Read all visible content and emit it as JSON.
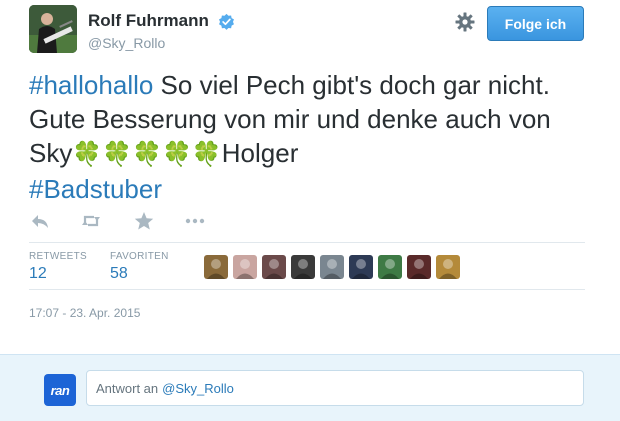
{
  "user": {
    "name": "Rolf Fuhrmann",
    "handle": "@Sky_Rollo"
  },
  "follow_button": {
    "label": "Folge ich"
  },
  "tweet": {
    "hashtag1": "#hallohallo",
    "text_part1": " So viel Pech gibt's doch gar nicht. Gute Besserung von mir und denke auch von Sky",
    "clovers": "🍀🍀🍀🍀🍀",
    "text_part2": "Holger",
    "hashtag2": "#Badstuber"
  },
  "actions": [
    "reply-icon",
    "retweet-icon",
    "favorite-icon",
    "more-icon"
  ],
  "stats": {
    "retweets_label": "RETWEETS",
    "retweets_value": "12",
    "favorites_label": "FAVORITEN",
    "favorites_value": "58"
  },
  "favoriters": [
    {
      "icon": "user-avatar",
      "color": "#8a6a3a"
    },
    {
      "icon": "user-avatar",
      "color": "#c9a5a0"
    },
    {
      "icon": "user-avatar",
      "color": "#6b4a4a"
    },
    {
      "icon": "user-avatar",
      "color": "#3a3a3a"
    },
    {
      "icon": "user-avatar",
      "color": "#7a8690"
    },
    {
      "icon": "user-avatar",
      "color": "#2d3a55"
    },
    {
      "icon": "user-avatar",
      "color": "#3e7a45"
    },
    {
      "icon": "user-avatar",
      "color": "#5a2a2a"
    },
    {
      "icon": "user-avatar",
      "color": "#b48a3a"
    }
  ],
  "timestamp": "17:07 - 23. Apr. 2015",
  "reply": {
    "avatar_text": "ran",
    "prefix": "Antwort an",
    "mention": "@Sky_Rollo"
  },
  "colors": {
    "link": "#2b7bb9",
    "muted": "#8899a6",
    "follow_button": "#3a95df",
    "reply_background": "#e8f4fb"
  }
}
